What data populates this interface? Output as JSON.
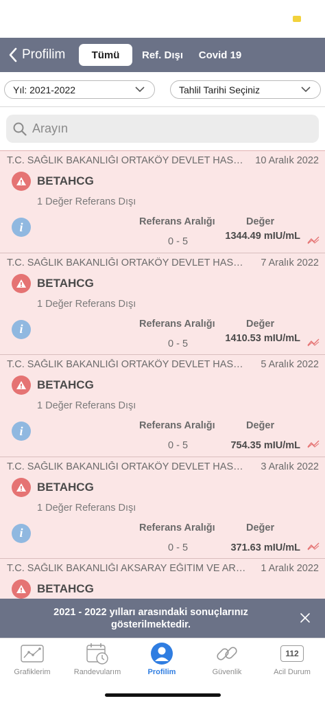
{
  "nav": {
    "back_label": "Profilim",
    "tabs": [
      {
        "label": "Tümü",
        "active": true
      },
      {
        "label": "Ref. Dışı",
        "active": false
      },
      {
        "label": "Covid 19",
        "active": false
      }
    ]
  },
  "filters": {
    "year_label": "Yıl: 2021-2022",
    "date_label": "Tahlil Tarihi Seçiniz"
  },
  "search": {
    "placeholder": "Arayın"
  },
  "results": {
    "range_header": "Referans Aralığı",
    "value_header": "Değer",
    "items": [
      {
        "institution": "T.C. SAĞLIK BAKANLIĞI ORTAKÖY DEVLET HASTANESİ",
        "date": "10 Aralık 2022",
        "test": "BETAHCG",
        "out_count": "1 Değer Referans Dışı",
        "range": "0 - 5",
        "value": "1344.49 mIU/mL"
      },
      {
        "institution": "T.C. SAĞLIK BAKANLIĞI ORTAKÖY DEVLET HASTANESİ",
        "date": "7 Aralık 2022",
        "test": "BETAHCG",
        "out_count": "1 Değer Referans Dışı",
        "range": "0 - 5",
        "value": "1410.53 mIU/mL"
      },
      {
        "institution": "T.C. SAĞLIK BAKANLIĞI ORTAKÖY DEVLET HASTANESİ",
        "date": "5 Aralık 2022",
        "test": "BETAHCG",
        "out_count": "1 Değer Referans Dışı",
        "range": "0 - 5",
        "value": "754.35 mIU/mL"
      },
      {
        "institution": "T.C. SAĞLIK BAKANLIĞI ORTAKÖY DEVLET HASTANESİ",
        "date": "3 Aralık 2022",
        "test": "BETAHCG",
        "out_count": "1 Değer Referans Dışı",
        "range": "0 - 5",
        "value": "371.63 mIU/mL"
      },
      {
        "institution": "T.C. SAĞLIK BAKANLIĞI AKSARAY EĞİTİM VE ARAŞTIRMA HASTANESİ",
        "date": "1 Aralık 2022",
        "test": "BETAHCG",
        "out_count": "",
        "range": "",
        "value": ""
      }
    ]
  },
  "banner": {
    "message": "2021 - 2022 yılları arasındaki sonuçlarınız gösterilmektedir."
  },
  "tabbar": {
    "items": [
      {
        "label": "Grafiklerim",
        "icon": "chart-icon"
      },
      {
        "label": "Randevularım",
        "icon": "calendar-clock-icon"
      },
      {
        "label": "Profilim",
        "icon": "user-icon",
        "active": true
      },
      {
        "label": "Güvenlik",
        "icon": "chain-link-icon"
      },
      {
        "label": "Acil Durum",
        "icon": "emergency-112-icon",
        "badge": "112"
      }
    ]
  },
  "colors": {
    "accent": "#2f7de1",
    "nav_bg": "#6b7287",
    "card_bg": "#fbe6e6",
    "warning": "#e57373",
    "info": "#90b8e0"
  }
}
